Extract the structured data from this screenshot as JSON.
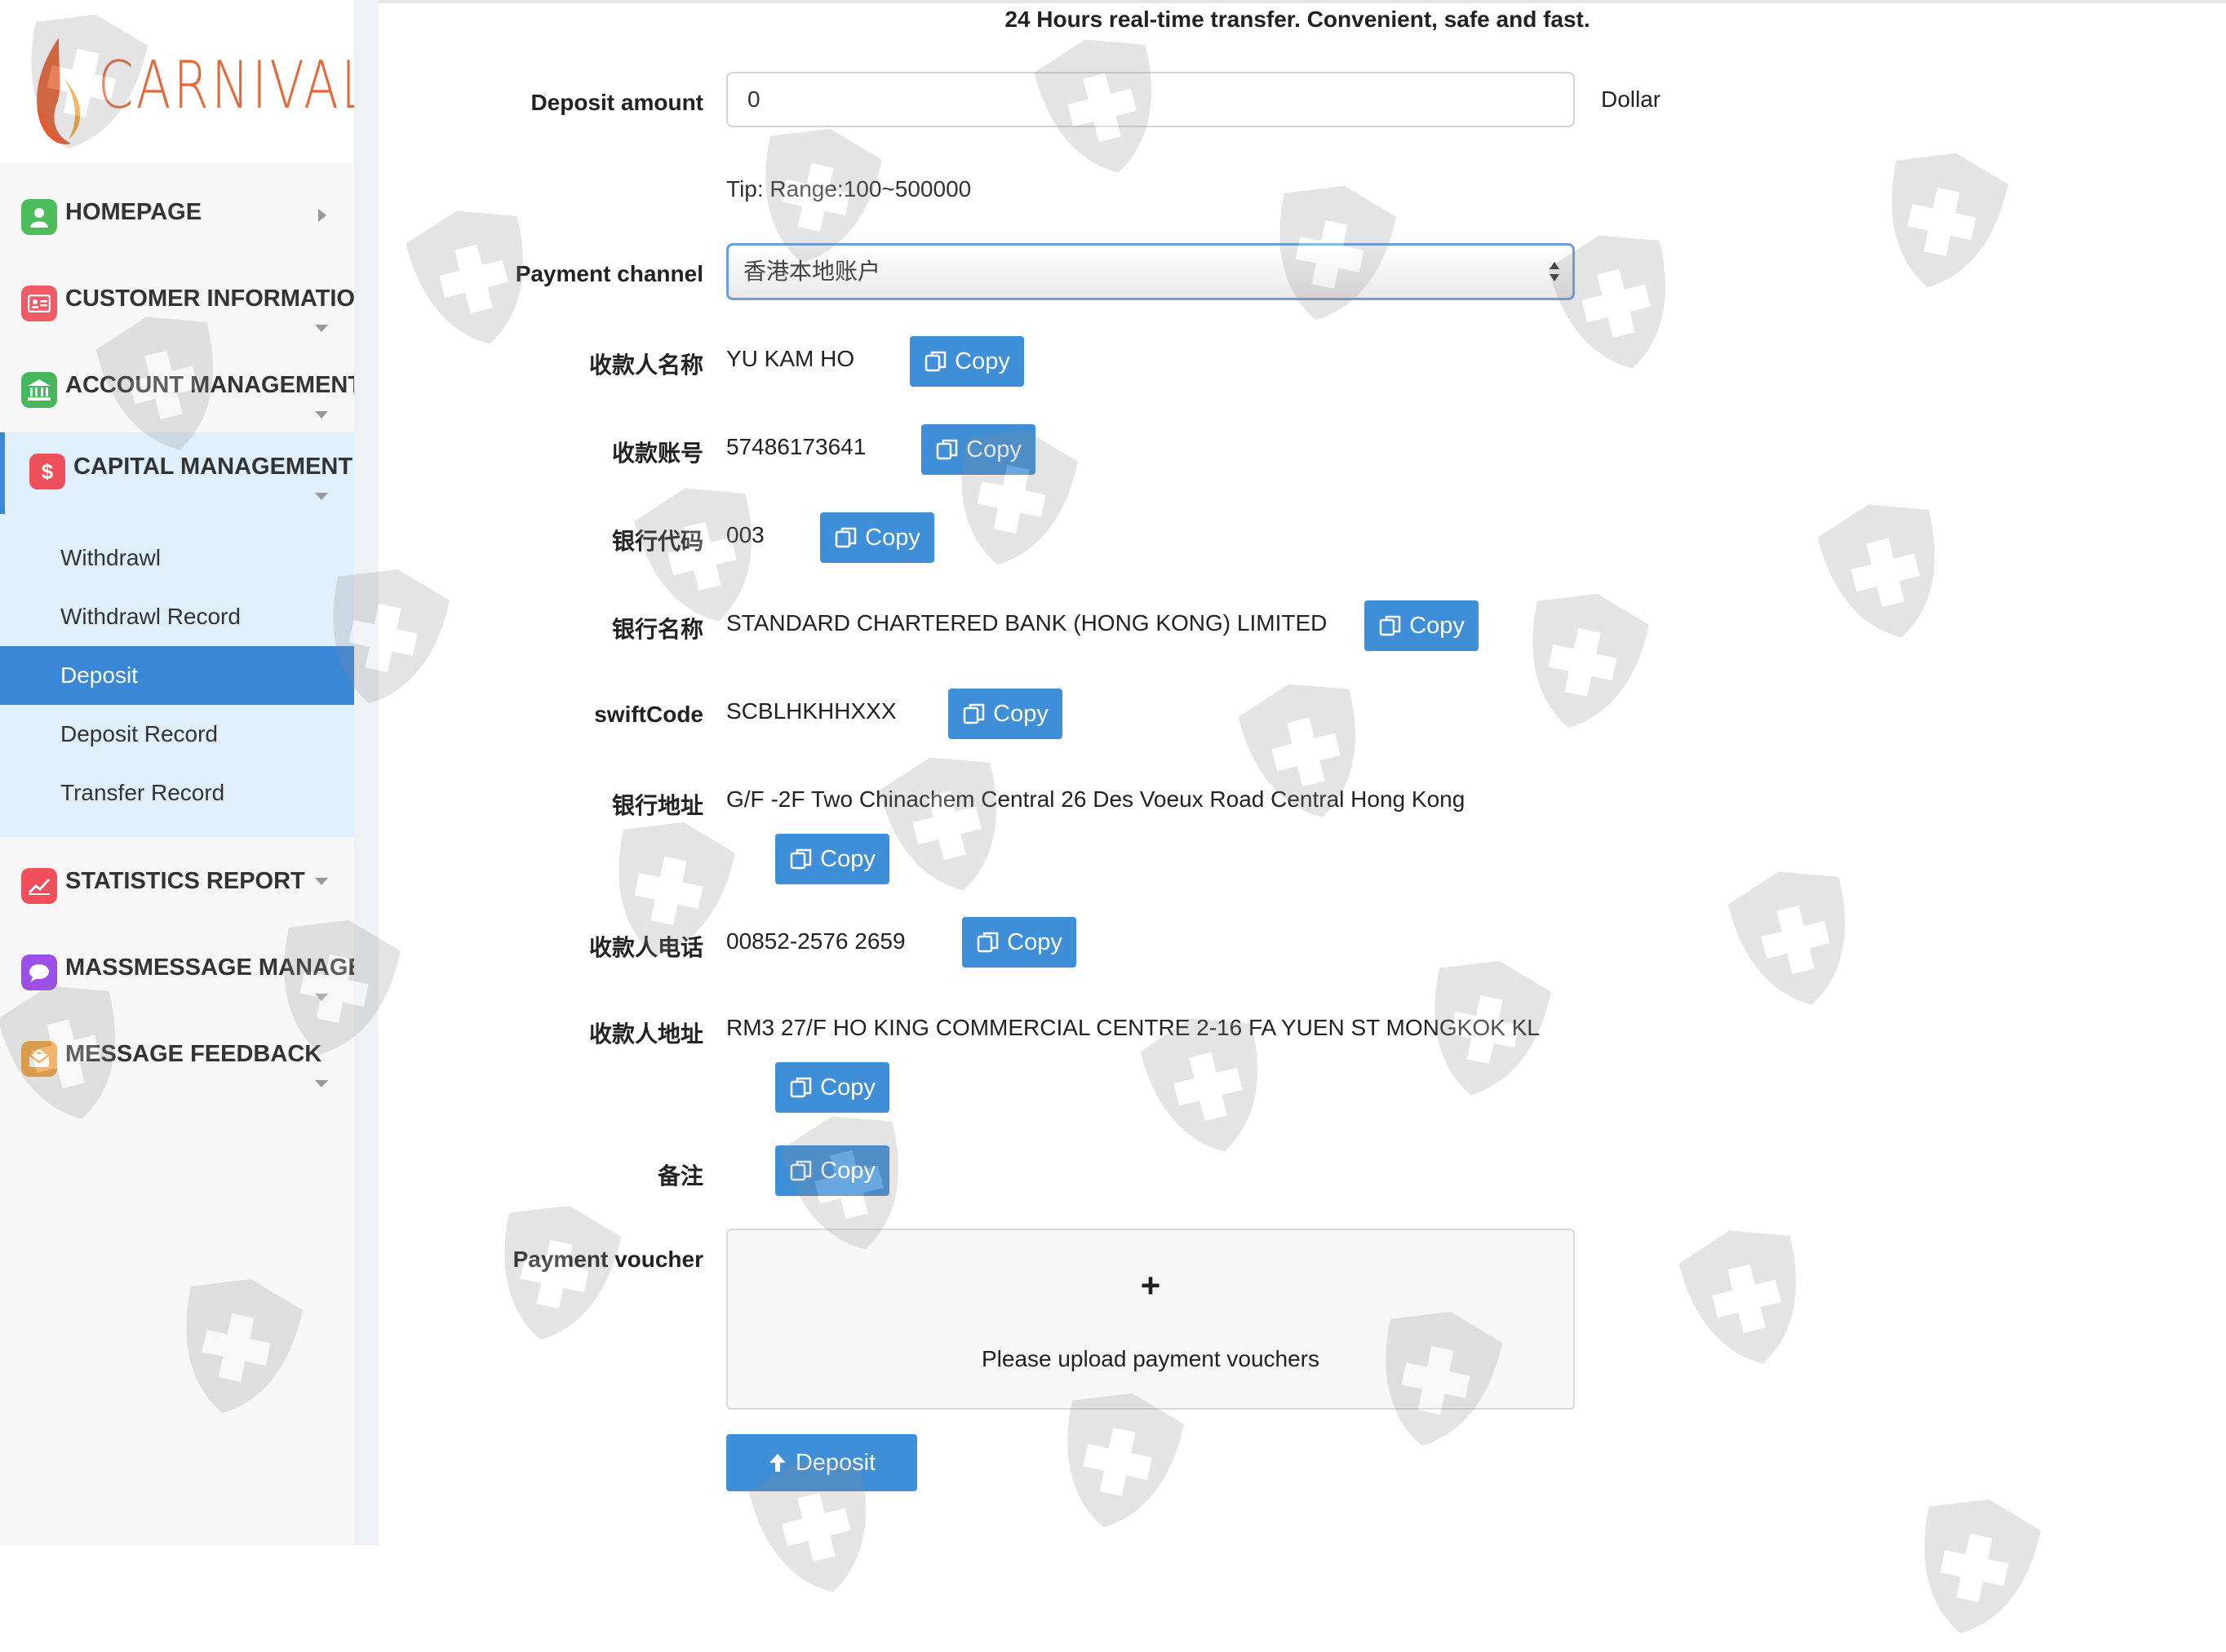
{
  "app": {
    "logo_text": "CARNIVAL"
  },
  "sidebar": {
    "items": [
      {
        "label": "HOMEPAGE",
        "icon": "user-icon",
        "color": "#4cbd5b"
      },
      {
        "label": "CUSTOMER INFORMATION",
        "icon": "id-card-icon",
        "color": "#ef5a64"
      },
      {
        "label": "ACCOUNT MANAGEMENT",
        "icon": "bank-icon",
        "color": "#44b85a"
      },
      {
        "label": "CAPITAL MANAGEMENT",
        "icon": "dollar-icon",
        "color": "#ef4f5a"
      },
      {
        "label": "STATISTICS REPORT",
        "icon": "chart-icon",
        "color": "#ef4f5a"
      },
      {
        "label": "MASSMESSAGE MANAGEMENT",
        "icon": "chat-bubble-icon",
        "color": "#9c4fe6"
      },
      {
        "label": "MESSAGE FEEDBACK",
        "icon": "envelope-icon",
        "color": "#f0a040"
      }
    ],
    "sub_items": [
      {
        "label": "Withdrawl"
      },
      {
        "label": "Withdrawl Record"
      },
      {
        "label": "Deposit",
        "active": true
      },
      {
        "label": "Deposit Record"
      },
      {
        "label": "Transfer Record"
      }
    ]
  },
  "main": {
    "notice": "24 Hours real-time transfer. Convenient, safe and fast.",
    "deposit_amount": {
      "label": "Deposit amount",
      "value": "0",
      "unit": "Dollar",
      "tip": "Tip: Range:100~500000"
    },
    "payment_channel": {
      "label": "Payment channel",
      "selected": "香港本地账户"
    },
    "copy_label": "Copy",
    "fields": [
      {
        "label": "收款人名称",
        "value": "YU KAM HO"
      },
      {
        "label": "收款账号",
        "value": "57486173641"
      },
      {
        "label": "银行代码",
        "value": "003"
      },
      {
        "label": "银行名称",
        "value": "STANDARD CHARTERED BANK (HONG KONG) LIMITED"
      },
      {
        "label": "swiftCode",
        "value": "SCBLHKHHXXX"
      },
      {
        "label": "银行地址",
        "value": "G/F -2F Two Chinachem Central 26 Des Voeux Road Central Hong Kong"
      },
      {
        "label": "收款人电话",
        "value": "00852-2576 2659"
      },
      {
        "label": "收款人地址",
        "value": "RM3 27/F HO KING COMMERCIAL CENTRE 2-16 FA YUEN ST MONGKOK KL"
      },
      {
        "label": "备注",
        "value": ""
      }
    ],
    "voucher": {
      "label": "Payment voucher",
      "plus": "+",
      "upload_text": "Please upload payment vouchers"
    },
    "deposit_button": "Deposit"
  },
  "colors": {
    "primary": "#3f8fd8",
    "sidebar_active_bg": "#dfeffb"
  }
}
